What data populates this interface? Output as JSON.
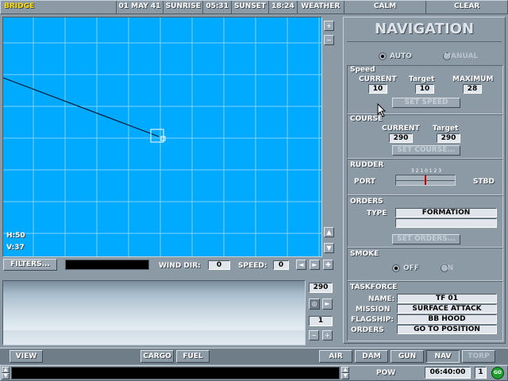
{
  "topbar": {
    "location": "BRIDGE",
    "date": "01 MAY 41",
    "sunrise_label": "SUNRISE",
    "sunrise_time": "05:31",
    "sunset_label": "SUNSET",
    "sunset_time": "18:24",
    "weather_label": "WEATHER",
    "sea": "CALM",
    "sky": "CLEAR"
  },
  "map": {
    "h_readout": "H:50",
    "v_readout": "V:37",
    "zoom_in_glyph": "+",
    "zoom_out_glyph": "−",
    "scroll_up_glyph": "▲",
    "scroll_down_glyph": "▼",
    "filters_label": "FILTERS...",
    "wind_dir_label": "WIND DIR:",
    "wind_dir_value": "0",
    "speed_label": "SPEED:",
    "speed_value": "0",
    "nav_left": "◄",
    "nav_right": "►",
    "nav_center": "✚"
  },
  "view": {
    "bearing": "290",
    "zoom": "1",
    "binocular_glyph": "◎",
    "right_glyph": "►",
    "minus_glyph": "−",
    "plus_glyph": "+"
  },
  "navigation": {
    "title": "NAVIGATION",
    "mode_auto": "AUTO",
    "mode_manual": "MANUAL",
    "speed": {
      "label": "Speed",
      "current_label": "CURRENT",
      "target_label": "Target",
      "maximum_label": "MAXIMUM",
      "current": "10",
      "target": "10",
      "maximum": "28",
      "set_button": "SET SPEED"
    },
    "course": {
      "label": "COURSE",
      "current_label": "CURRENT",
      "target_label": "Target",
      "current": "290",
      "target": "290",
      "set_button": "SET COURSE..."
    },
    "rudder": {
      "label": "RUDDER",
      "port": "PORT",
      "stbd": "STBD",
      "scale": "3 2 1 0 1 2 3",
      "position": 0
    },
    "orders": {
      "label": "ORDERS",
      "type_label": "TYPE",
      "type_value": "FORMATION",
      "set_button": "SET ORDERS..."
    },
    "smoke": {
      "label": "SMOKE",
      "off": "OFF",
      "on": "ON"
    },
    "taskforce": {
      "label": "TASKFORCE",
      "name_label": "NAME:",
      "name": "TF 01",
      "mission_label": "MISSION",
      "mission": "SURFACE ATTACK",
      "flagship_label": "FLAGSHIP:",
      "flagship": "BB  HOOD",
      "orders_label": "ORDERS",
      "orders": "GO TO POSITION"
    }
  },
  "bottom_tabs": {
    "view": "VIEW",
    "cargo": "CARGO",
    "fuel": "FUEL",
    "air": "AIR",
    "dam": "DAM",
    "gun": "GUN",
    "nav": "NAV",
    "torp": "TORP"
  },
  "statusbar": {
    "pow": "POW",
    "clock": "06:40:00",
    "speed_multiplier": "1",
    "go": "GO"
  },
  "colors": {
    "map_water": "#00aaff",
    "grid": "#7fd0f5",
    "panel": "#8c9aa6",
    "rudder_needle": "#cc0000",
    "go_button": "#1e9e2e"
  }
}
